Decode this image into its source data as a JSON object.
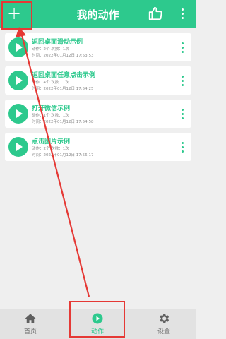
{
  "header": {
    "add_label": "+",
    "title": "我的动作"
  },
  "actions": [
    {
      "name": "返回桌面滑动示例",
      "meta1": "动作：2个  次数：1次",
      "meta2": "时间：2022年01月12日 17:53:53"
    },
    {
      "name": "返回桌面任意点击示例",
      "meta1": "动作：4个  次数：1次",
      "meta2": "时间：2022年01月12日 17:54:25"
    },
    {
      "name": "打开微信示例",
      "meta1": "动作：1个  次数：1次",
      "meta2": "时间：2022年01月12日 17:54:58"
    },
    {
      "name": "点击图片示例",
      "meta1": "动作：2个  次数：1次",
      "meta2": "时间：2022年01月12日 17:56:17"
    }
  ],
  "tabs": [
    {
      "label": "首页",
      "icon": "home-icon"
    },
    {
      "label": "动作",
      "icon": "play-circle-icon",
      "active": true
    },
    {
      "label": "设置",
      "icon": "gear-icon"
    }
  ],
  "colors": {
    "accent": "#2dc98d",
    "annotation": "#e53935"
  }
}
